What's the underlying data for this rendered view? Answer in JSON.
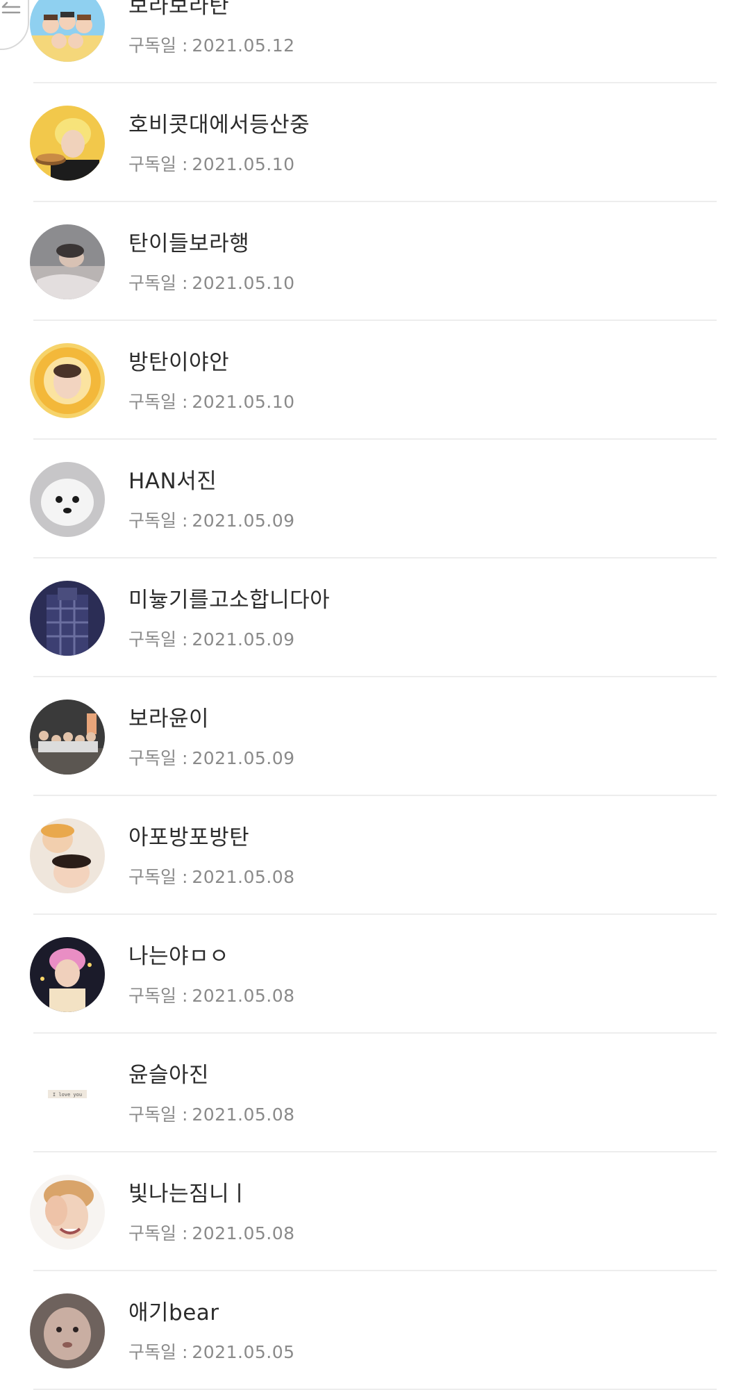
{
  "subscription_label": "구독일 :",
  "subscribers": [
    {
      "nickname": "보라보라탄",
      "date": "2021.05.12",
      "avatar": "cartoon-group-avatar"
    },
    {
      "nickname": "호비콧대에서등산중",
      "date": "2021.05.10",
      "avatar": "yellow-hair-person-avatar"
    },
    {
      "nickname": "탄이들보라행",
      "date": "2021.05.10",
      "avatar": "person-lying-avatar"
    },
    {
      "nickname": "방탄이야안",
      "date": "2021.05.10",
      "avatar": "sunflower-face-avatar"
    },
    {
      "nickname": "HAN서진",
      "date": "2021.05.09",
      "avatar": "white-puppy-avatar"
    },
    {
      "nickname": "미늏기를고소합니다아",
      "date": "2021.05.09",
      "avatar": "plaid-outfit-avatar"
    },
    {
      "nickname": "보라윤이",
      "date": "2021.05.09",
      "avatar": "group-photo-avatar"
    },
    {
      "nickname": "아포방포방탄",
      "date": "2021.05.08",
      "avatar": "two-faces-avatar"
    },
    {
      "nickname": "나는야ㅁㅇ",
      "date": "2021.05.08",
      "avatar": "pink-hair-person-avatar"
    },
    {
      "nickname": "윤슬아진",
      "date": "2021.05.08",
      "avatar": "i-love-you-note-avatar"
    },
    {
      "nickname": "빛나는짐니ㅣ",
      "date": "2021.05.08",
      "avatar": "smiling-person-avatar"
    },
    {
      "nickname": "애기bear",
      "date": "2021.05.05",
      "avatar": "baby-face-avatar"
    }
  ],
  "avatar_note_text": "I love you",
  "colors": {
    "nickname": "#2b2b2b",
    "date": "#8a8a8a",
    "divider": "#ededed"
  }
}
